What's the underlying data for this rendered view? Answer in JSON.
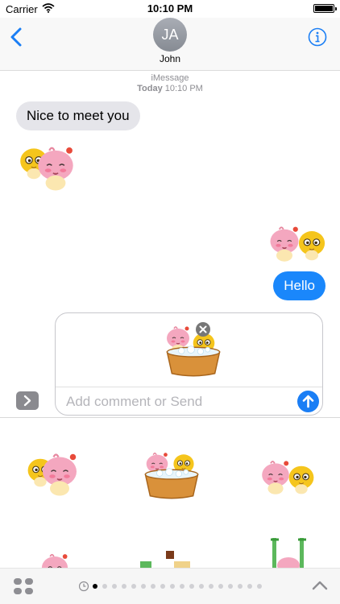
{
  "status_bar": {
    "carrier": "Carrier",
    "time": "10:10 PM"
  },
  "nav": {
    "contact_initials": "JA",
    "contact_name": "John"
  },
  "conversation": {
    "service": "iMessage",
    "day": "Today",
    "time": "10:10 PM",
    "incoming_message": "Nice to meet you",
    "outgoing_message": "Hello"
  },
  "compose": {
    "placeholder": "Add comment or Send"
  },
  "colors": {
    "accent": "#1a87fb",
    "incoming_bubble": "#e5e5ea"
  },
  "icons": [
    "back-chevron",
    "info",
    "expand-chevron",
    "remove",
    "send-arrow",
    "apps-grid",
    "recents-clock",
    "chevron-up"
  ],
  "drawer": {
    "page_count": 16,
    "current_page": 1
  }
}
